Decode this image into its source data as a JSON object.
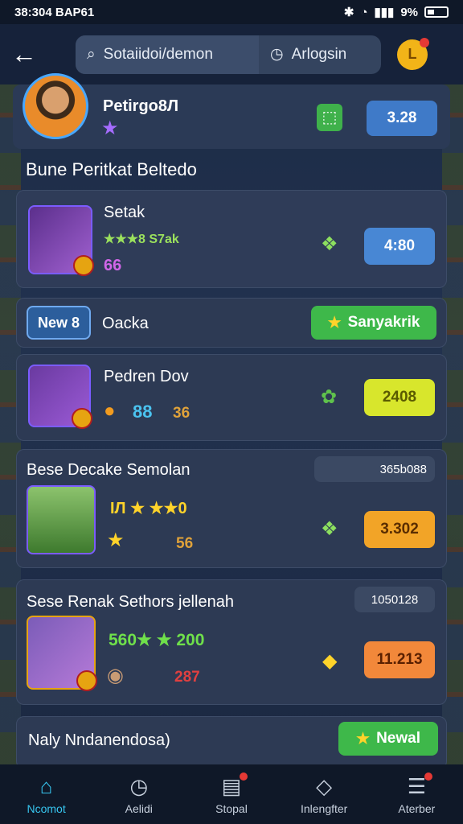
{
  "status_bar": {
    "time": "38:304 BAP61",
    "battery": "9%"
  },
  "header": {
    "search_placeholder": "Sotaiidoi/demon",
    "filter_label": "Arlogsin"
  },
  "profile": {
    "name": "Petirgo8Л",
    "value": "3.28"
  },
  "section_title": "Bune Peritkat Beltedo",
  "cards": [
    {
      "title": "Setak",
      "rating": "★★★8 S7ak",
      "count": "66",
      "price": "4:80"
    },
    {
      "tag": "New 8",
      "label": "Oacka",
      "action": "Sanyakrik"
    },
    {
      "title": "Pedren Dov",
      "stat1": "88",
      "stat2": "36",
      "price": "2408"
    },
    {
      "title": "Bese Decake Semolan",
      "meta": "365b088",
      "rating": "ІЛ ★ ★★0",
      "stat": "56",
      "price": "3.302"
    },
    {
      "title": "Sese Renak Sethors jellenah",
      "meta": "1050128",
      "rating": "560★ ★ 200",
      "stat": "287",
      "price": "11.213"
    },
    {
      "title": "Naly Nndanendosa)",
      "action": "Newal"
    }
  ],
  "nav": [
    {
      "label": "Ncomot",
      "icon": "home-icon",
      "active": true
    },
    {
      "label": "Aelidi",
      "icon": "clock-icon",
      "active": false
    },
    {
      "label": "Stopal",
      "icon": "card-icon",
      "active": false
    },
    {
      "label": "Inlengfter",
      "icon": "diamond-icon",
      "active": false
    },
    {
      "label": "Aterber",
      "icon": "stack-icon",
      "active": false
    }
  ],
  "colors": {
    "accent_blue": "#3f7ac8",
    "accent_green": "#3fb14b",
    "accent_yellow": "#d8e62c",
    "accent_orange": "#f2a427"
  }
}
